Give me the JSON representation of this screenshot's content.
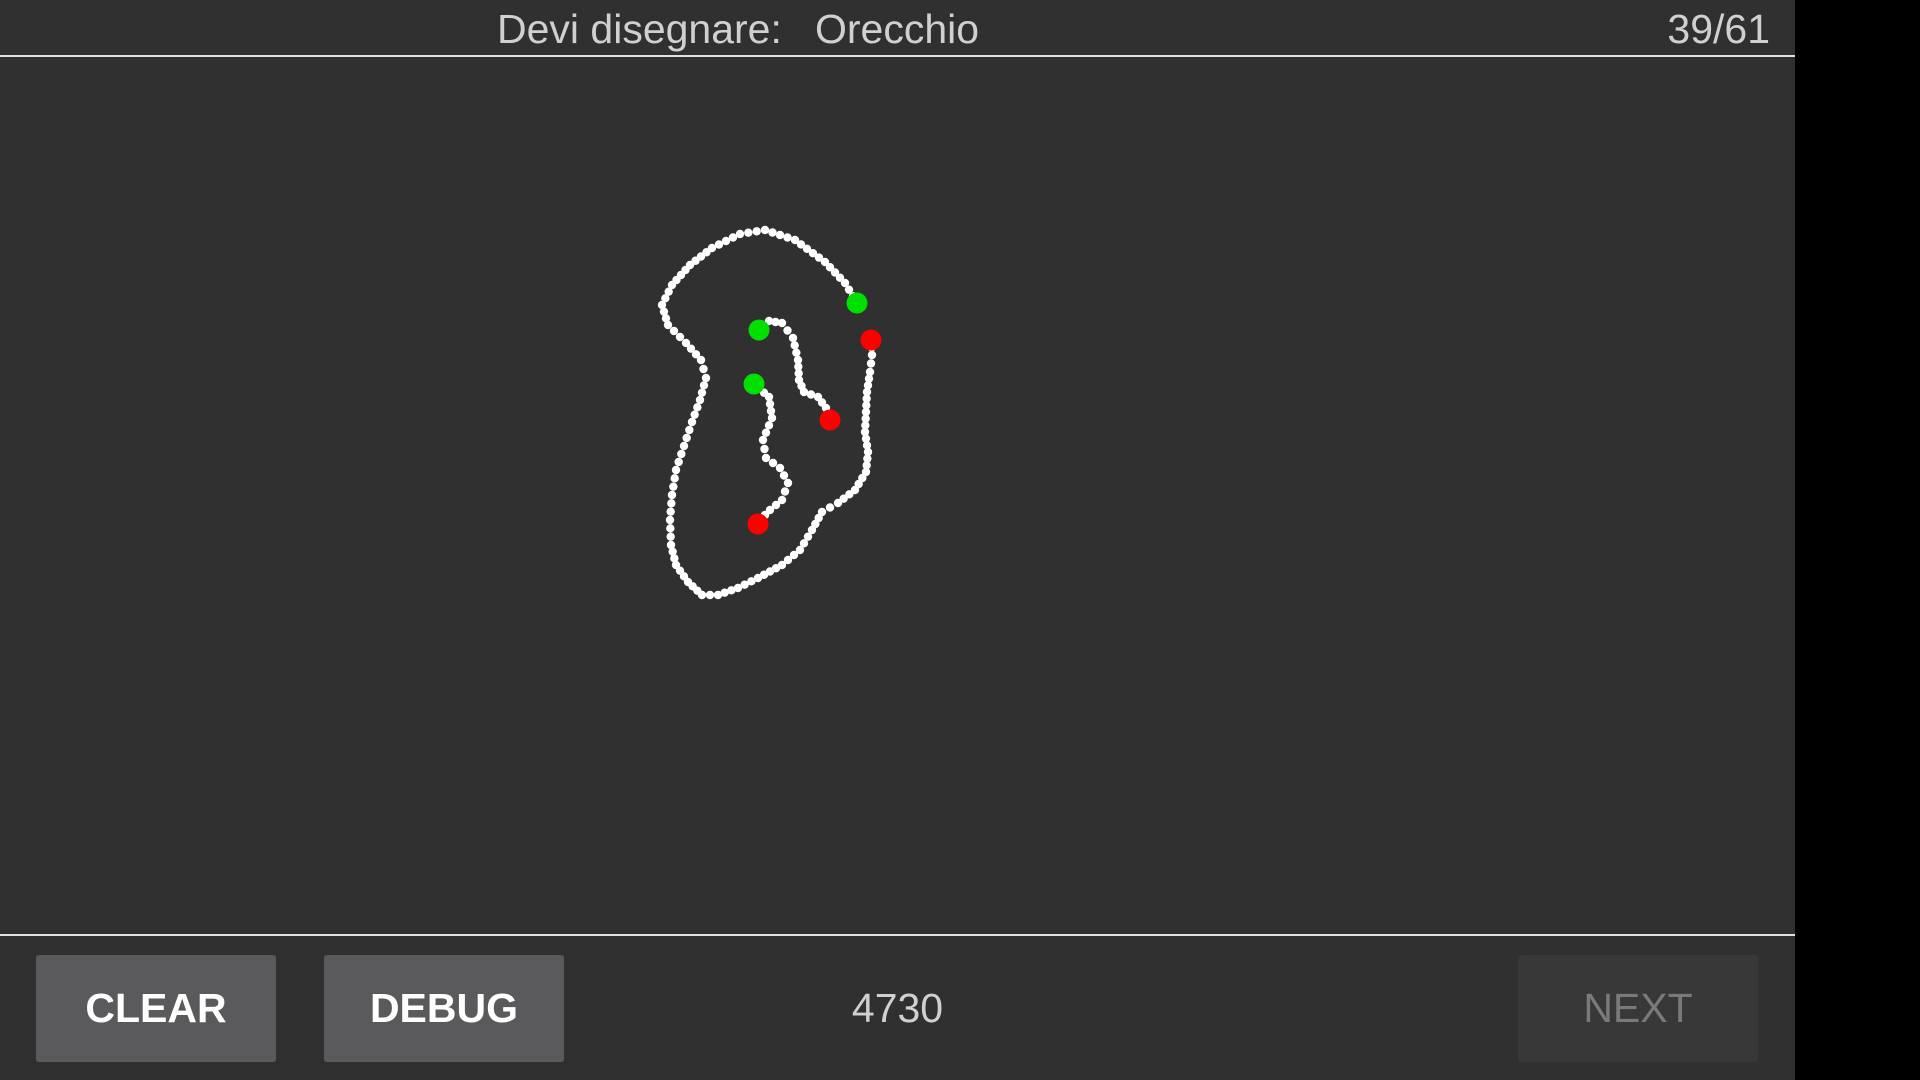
{
  "header": {
    "prompt_label": "Devi disegnare:",
    "target_word": "Orecchio",
    "progress": "39/61"
  },
  "footer": {
    "clear_label": "CLEAR",
    "debug_label": "DEBUG",
    "counter": "4730",
    "next_label": "NEXT"
  },
  "colors": {
    "background": "#303030",
    "stroke_point": "#ffffff",
    "stroke_start": "#00e000",
    "stroke_end": "#ff0000",
    "button": "#5a5a5c",
    "button_disabled": "#383838"
  },
  "icons": []
}
